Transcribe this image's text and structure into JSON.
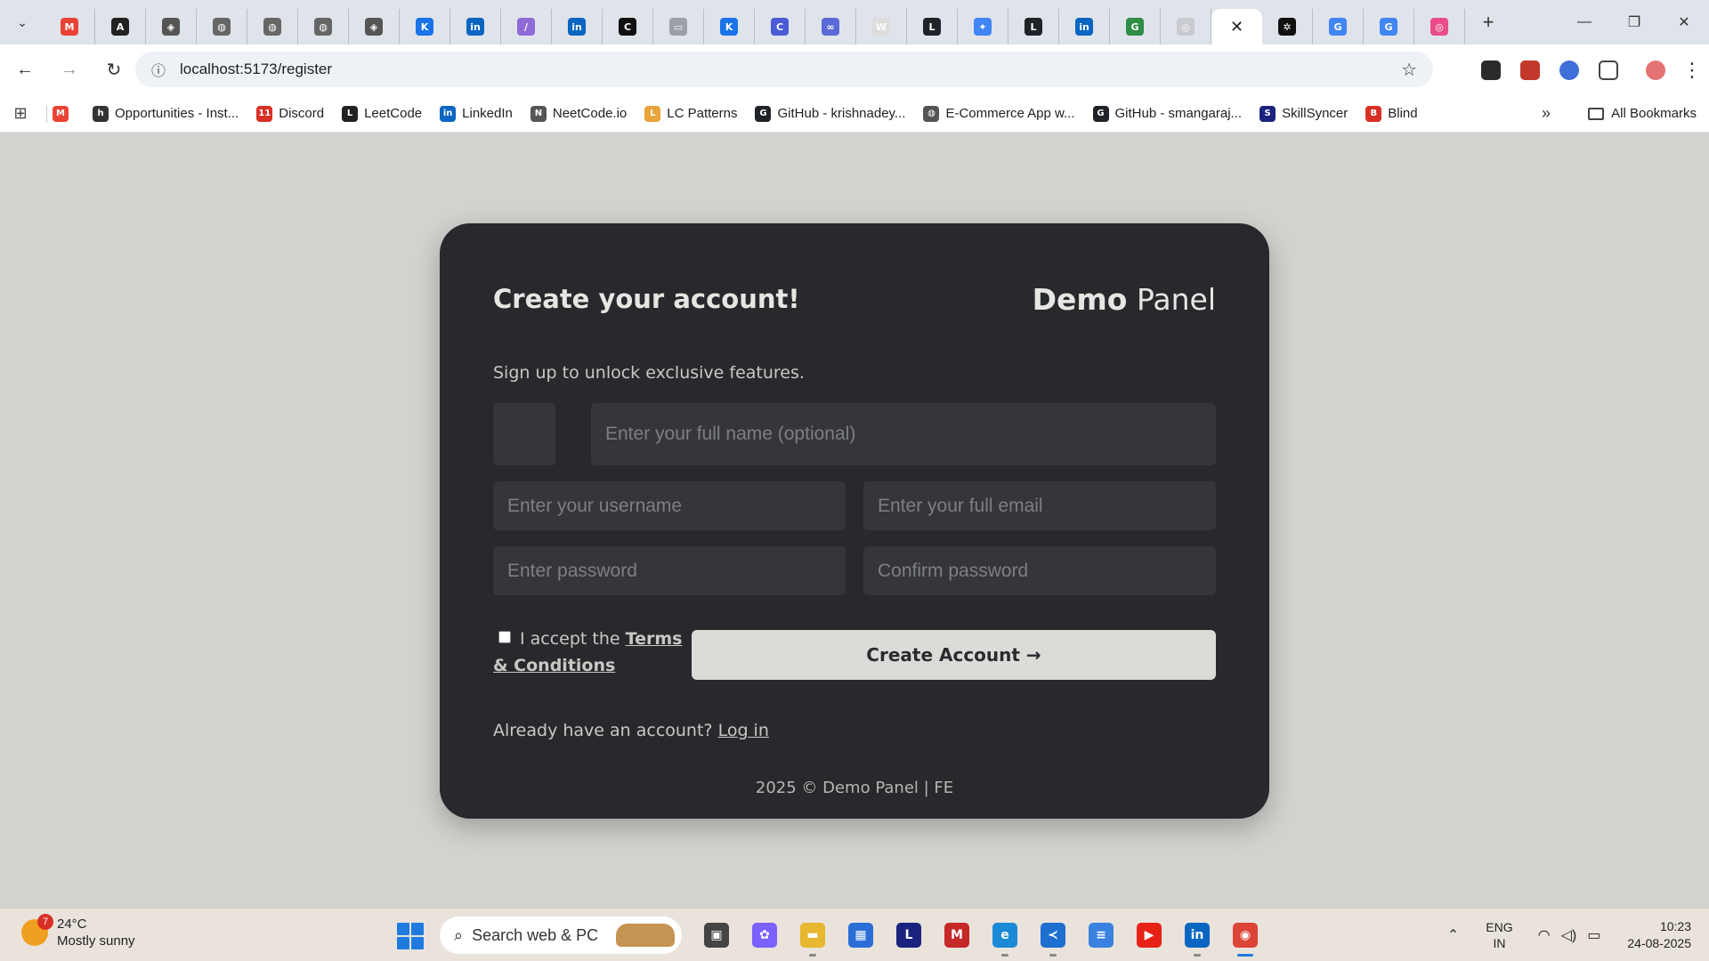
{
  "browser": {
    "tabs": [
      {
        "icon": "gmail-icon",
        "color": "#ea4335",
        "glyph": "M"
      },
      {
        "icon": "app-icon",
        "color": "#222222",
        "glyph": "A"
      },
      {
        "icon": "box-icon",
        "color": "#555555",
        "glyph": "◈"
      },
      {
        "icon": "globe-icon",
        "color": "#666666",
        "glyph": "◍"
      },
      {
        "icon": "globe-icon",
        "color": "#666666",
        "glyph": "◍"
      },
      {
        "icon": "globe-icon",
        "color": "#666666",
        "glyph": "◍"
      },
      {
        "icon": "box-icon",
        "color": "#555555",
        "glyph": "◈"
      },
      {
        "icon": "kite-icon",
        "color": "#1a73e8",
        "glyph": "K"
      },
      {
        "icon": "linkedin-icon",
        "color": "#0a66c2",
        "glyph": "in"
      },
      {
        "icon": "stripe-icon",
        "color": "#8e6bd6",
        "glyph": "∕"
      },
      {
        "icon": "linkedin-icon",
        "color": "#0a66c2",
        "glyph": "in"
      },
      {
        "icon": "app-icon",
        "color": "#111111",
        "glyph": "C"
      },
      {
        "icon": "image-icon",
        "color": "#9aa0a6",
        "glyph": "▭"
      },
      {
        "icon": "kite-icon",
        "color": "#1a73e8",
        "glyph": "K"
      },
      {
        "icon": "copilot-icon",
        "color": "#4b5bd6",
        "glyph": "C"
      },
      {
        "icon": "app-icon",
        "color": "#5a6bd8",
        "glyph": "∞"
      },
      {
        "icon": "wiki-icon",
        "color": "#dddddd",
        "glyph": "W"
      },
      {
        "icon": "leetcode-icon",
        "color": "#1f2328",
        "glyph": "L"
      },
      {
        "icon": "gemini-icon",
        "color": "#4285f4",
        "glyph": "✦"
      },
      {
        "icon": "leetcode-icon",
        "color": "#1f2328",
        "glyph": "L"
      },
      {
        "icon": "linkedin-icon",
        "color": "#0a66c2",
        "glyph": "in"
      },
      {
        "icon": "geeks-icon",
        "color": "#2f8d46",
        "glyph": "G"
      },
      {
        "icon": "openai-icon",
        "color": "#c9c9d0",
        "glyph": "◎"
      }
    ],
    "active_tab": {
      "close_glyph": "✕"
    },
    "tabs_after": [
      {
        "icon": "app-icon",
        "color": "#111111",
        "glyph": "✲"
      },
      {
        "icon": "google-icon",
        "color": "#4285f4",
        "glyph": "G"
      },
      {
        "icon": "google-icon",
        "color": "#4285f4",
        "glyph": "G"
      },
      {
        "icon": "dribbble-icon",
        "color": "#ea4c89",
        "glyph": "◎"
      }
    ],
    "new_tab_glyph": "+",
    "url": "localhost:5173/register"
  },
  "bookmarks": {
    "items": [
      {
        "label": "",
        "icon": "gmail-icon",
        "color": "#ea4335",
        "glyph": "M"
      },
      {
        "label": "Opportunities - Inst...",
        "icon": "internshala-icon",
        "color": "#333333",
        "glyph": "h"
      },
      {
        "label": "Discord",
        "icon": "discord-icon",
        "color": "#d93025",
        "glyph": "11"
      },
      {
        "label": "LeetCode",
        "icon": "leetcode-icon",
        "color": "#222222",
        "glyph": "L"
      },
      {
        "label": "LinkedIn",
        "icon": "linkedin-icon",
        "color": "#0a66c2",
        "glyph": "in"
      },
      {
        "label": "NeetCode.io",
        "icon": "neetcode-icon",
        "color": "#555555",
        "glyph": "N"
      },
      {
        "label": "LC Patterns",
        "icon": "patterns-icon",
        "color": "#e8a33d",
        "glyph": "L"
      },
      {
        "label": "GitHub - krishnadey...",
        "icon": "github-icon",
        "color": "#1f2328",
        "glyph": "G"
      },
      {
        "label": "E-Commerce App w...",
        "icon": "globe-icon",
        "color": "#555555",
        "glyph": "◍"
      },
      {
        "label": "GitHub - smangaraj...",
        "icon": "github-icon",
        "color": "#1f2328",
        "glyph": "G"
      },
      {
        "label": "SkillSyncer",
        "icon": "skillsyncer-icon",
        "color": "#1a237e",
        "glyph": "S"
      },
      {
        "label": "Blind",
        "icon": "blind-icon",
        "color": "#d93025",
        "glyph": "B"
      }
    ],
    "more_glyph": "»",
    "all_label": "All Bookmarks"
  },
  "page": {
    "title": "Create your account!",
    "brand_bold": "Demo",
    "brand_light": "Panel",
    "subtitle": "Sign up to unlock exclusive features.",
    "fields": {
      "name_placeholder": "Enter your full name (optional)",
      "username_placeholder": "Enter your username",
      "email_placeholder": "Enter your full email",
      "password_placeholder": "Enter password",
      "confirm_placeholder": "Confirm password"
    },
    "terms_prefix": "I accept the",
    "terms_link": "Terms & Conditions",
    "create_button": "Create Account →",
    "login_prefix": "Already have an account?",
    "login_link": "Log in",
    "footer": "2025 © Demo Panel | FE"
  },
  "taskbar": {
    "weather_temp": "24°C",
    "weather_desc": "Mostly sunny",
    "weather_badge": "7",
    "search_label": "Search web & PC",
    "apps": [
      {
        "icon": "task-view-icon",
        "color": "#444444",
        "glyph": "▣",
        "running": false
      },
      {
        "icon": "copilot-icon",
        "color": "#7b61ff",
        "glyph": "✿",
        "running": false
      },
      {
        "icon": "file-explorer-icon",
        "color": "#e8b730",
        "glyph": "▬",
        "running": true
      },
      {
        "icon": "store-icon",
        "color": "#2b6fd6",
        "glyph": "▦",
        "running": false
      },
      {
        "icon": "l-app-icon",
        "color": "#1a237e",
        "glyph": "L",
        "running": false
      },
      {
        "icon": "mcafee-icon",
        "color": "#c62828",
        "glyph": "M",
        "running": false
      },
      {
        "icon": "edge-icon",
        "color": "#1b8ad6",
        "glyph": "e",
        "running": true
      },
      {
        "icon": "vscode-icon",
        "color": "#1f6fd0",
        "glyph": "≺",
        "running": true
      },
      {
        "icon": "notepad-icon",
        "color": "#3a82e0",
        "glyph": "≡",
        "running": false
      },
      {
        "icon": "youtube-icon",
        "color": "#e62117",
        "glyph": "▶",
        "running": false
      },
      {
        "icon": "linkedin-icon",
        "color": "#0a66c2",
        "glyph": "in",
        "running": true
      },
      {
        "icon": "chrome-icon",
        "color": "#db4437",
        "glyph": "◉",
        "running": true,
        "active": true
      }
    ],
    "lang_top": "ENG",
    "lang_bottom": "IN",
    "time": "10:23",
    "date": "24-08-2025"
  }
}
